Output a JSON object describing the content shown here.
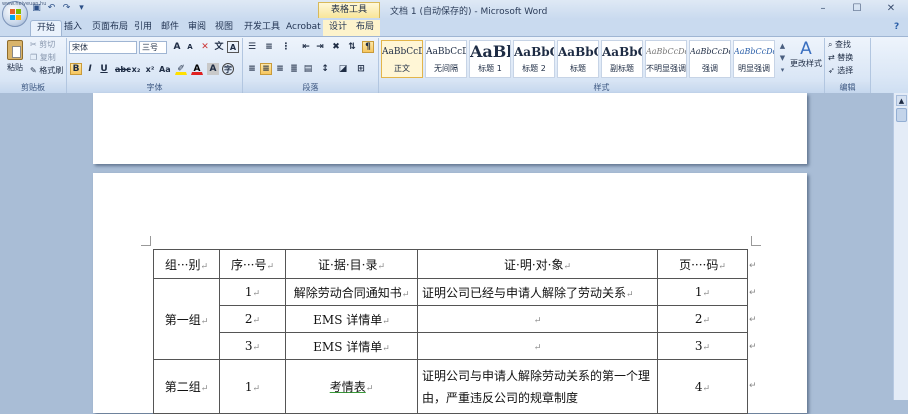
{
  "watermark": "www.heiyeuan.hu",
  "title_bar": {
    "document_title": "文档 1 (自动保存的) - Microsoft Word",
    "context_group": "表格工具",
    "quick_access": [
      "save-icon",
      "undo-icon",
      "redo-icon",
      "customize-icon"
    ],
    "window_controls": {
      "minimize": "–",
      "restore": "☐",
      "close": "✕"
    }
  },
  "tabs": [
    {
      "label": "开始",
      "active": true
    },
    {
      "label": "插入"
    },
    {
      "label": "页面布局"
    },
    {
      "label": "引用"
    },
    {
      "label": "邮件"
    },
    {
      "label": "审阅"
    },
    {
      "label": "视图"
    },
    {
      "label": "开发工具"
    },
    {
      "label": "Acrobat"
    },
    {
      "label": "设计",
      "contextual": true
    },
    {
      "label": "布局",
      "contextual": true
    }
  ],
  "help_icon": "?",
  "ribbon": {
    "clipboard": {
      "label": "剪贴板",
      "paste": "粘贴",
      "cut": "剪切",
      "copy": "复制",
      "format_painter": "格式刷"
    },
    "font": {
      "label": "字体",
      "font_name": "宋体",
      "font_size": "三号"
    },
    "paragraph": {
      "label": "段落"
    },
    "styles": {
      "label": "样式",
      "items": [
        {
          "sample": "AaBbCcDc",
          "name": "正文",
          "selected": true
        },
        {
          "sample": "AaBbCcDc",
          "name": "无间隔"
        },
        {
          "sample": "AaBl",
          "name": "标题 1"
        },
        {
          "sample": "AaBbC",
          "name": "标题 2"
        },
        {
          "sample": "AaBbC",
          "name": "标题"
        },
        {
          "sample": "AaBbC",
          "name": "副标题"
        },
        {
          "sample": "AaBbCcDd",
          "name": "不明显强调"
        },
        {
          "sample": "AaBbCcDd",
          "name": "强调"
        },
        {
          "sample": "AaBbCcDd",
          "name": "明显强调"
        }
      ],
      "change_styles": "更改样式"
    },
    "editing": {
      "label": "编辑",
      "find": "查找",
      "replace": "替换",
      "select": "选择"
    }
  },
  "table": {
    "headers": [
      "组···别",
      "序···号",
      "证·据·目·录",
      "证·明·对·象",
      "页····码"
    ],
    "group1": "第一组",
    "group2": "第二组",
    "rows": [
      {
        "no": "1",
        "evidence": "解除劳动合同通知书",
        "purpose": "证明公司已经与申请人解除了劳动关系",
        "page": "1"
      },
      {
        "no": "2",
        "evidence": "EMS 详情单",
        "purpose": "",
        "page": "2"
      },
      {
        "no": "3",
        "evidence": "EMS 详情单",
        "purpose": "",
        "page": "3"
      },
      {
        "no": "1",
        "evidence": "考情表",
        "purpose": "证明公司与申请人解除劳动关系的第一个理由，严重违反公司的规章制度",
        "page": "4"
      }
    ],
    "cell_mark": "↵"
  },
  "colors": {
    "ribbon_bg": "#dbe7f6",
    "workspace": "#a9bdd6",
    "active_tab": "#eaf2fc",
    "context_tab": "#fdf3cc"
  }
}
